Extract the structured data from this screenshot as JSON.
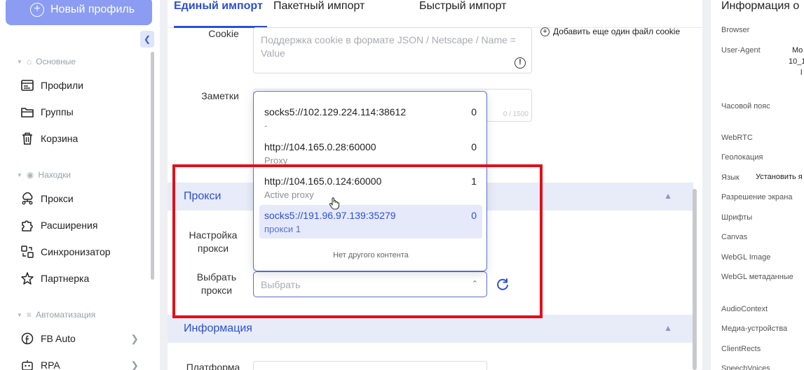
{
  "sidebar": {
    "new_profile": "Новый профиль",
    "sections": {
      "main": "Основные",
      "finds": "Находки",
      "automation": "Автоматизация"
    },
    "items": {
      "profiles": "Профили",
      "groups": "Группы",
      "trash": "Корзина",
      "proxies": "Прокси",
      "extensions": "Расширения",
      "sync": "Синхронизатор",
      "partner": "Партнерка",
      "fb_auto": "FB Auto",
      "rpa": "RPA"
    }
  },
  "tabs": [
    "Единый импорт",
    "Пакетный импорт",
    "Быстрый импорт"
  ],
  "form": {
    "cookie_label": "Cookie",
    "cookie_placeholder": "Поддержка cookie в формате JSON / Netscape / Name = Value",
    "add_cookie": "Добавить еще один файл cookie",
    "notes_label": "Заметки",
    "notes_counter": "0 / 1500",
    "proxy_section": "Прокси",
    "proxy_setup_label": "Настройка прокси",
    "choose_proxy_label": "Выбрать прокси",
    "choose_placeholder": "Выбрать",
    "info_section": "Информация",
    "platform_label": "Платформа"
  },
  "dropdown": {
    "options": [
      {
        "address": "socks5://102.129.224.114:38612",
        "note": "-",
        "count": "0"
      },
      {
        "address": "http://104.165.0.28:60000",
        "note": "Proxy",
        "count": "0"
      },
      {
        "address": "http://104.165.0.124:60000",
        "note": "Active proxy",
        "count": "1"
      },
      {
        "address": "socks5://191.96.97.139:35279",
        "note": "прокси 1",
        "count": "0"
      }
    ],
    "no_more": "Нет другого контента"
  },
  "info_panel": {
    "title": "Информация о",
    "labels": {
      "browser": "Browser",
      "user_agent": "User-Agent",
      "timezone": "Часовой пояс",
      "webrtc": "WebRTC",
      "geolocation": "Геолокация",
      "language": "Язык",
      "resolution": "Разрешение экрана",
      "fonts": "Шрифты",
      "canvas": "Canvas",
      "webgl_image": "WebGL Image",
      "webgl_meta": "WebGL метаданные",
      "audio": "AudioContext",
      "media": "Медиа-устройства",
      "client_rects": "ClientRects",
      "speech": "SpeechVoices"
    },
    "values": {
      "ua_line1": "Mo",
      "ua_line2": "10_1",
      "ua_line3": "l",
      "language": "Установить я"
    }
  },
  "colors": {
    "accent": "#2c4fd3",
    "new_profile_bg": "#8b9cf2",
    "highlight": "#e0101a",
    "section_bg": "#e8ecf8"
  }
}
